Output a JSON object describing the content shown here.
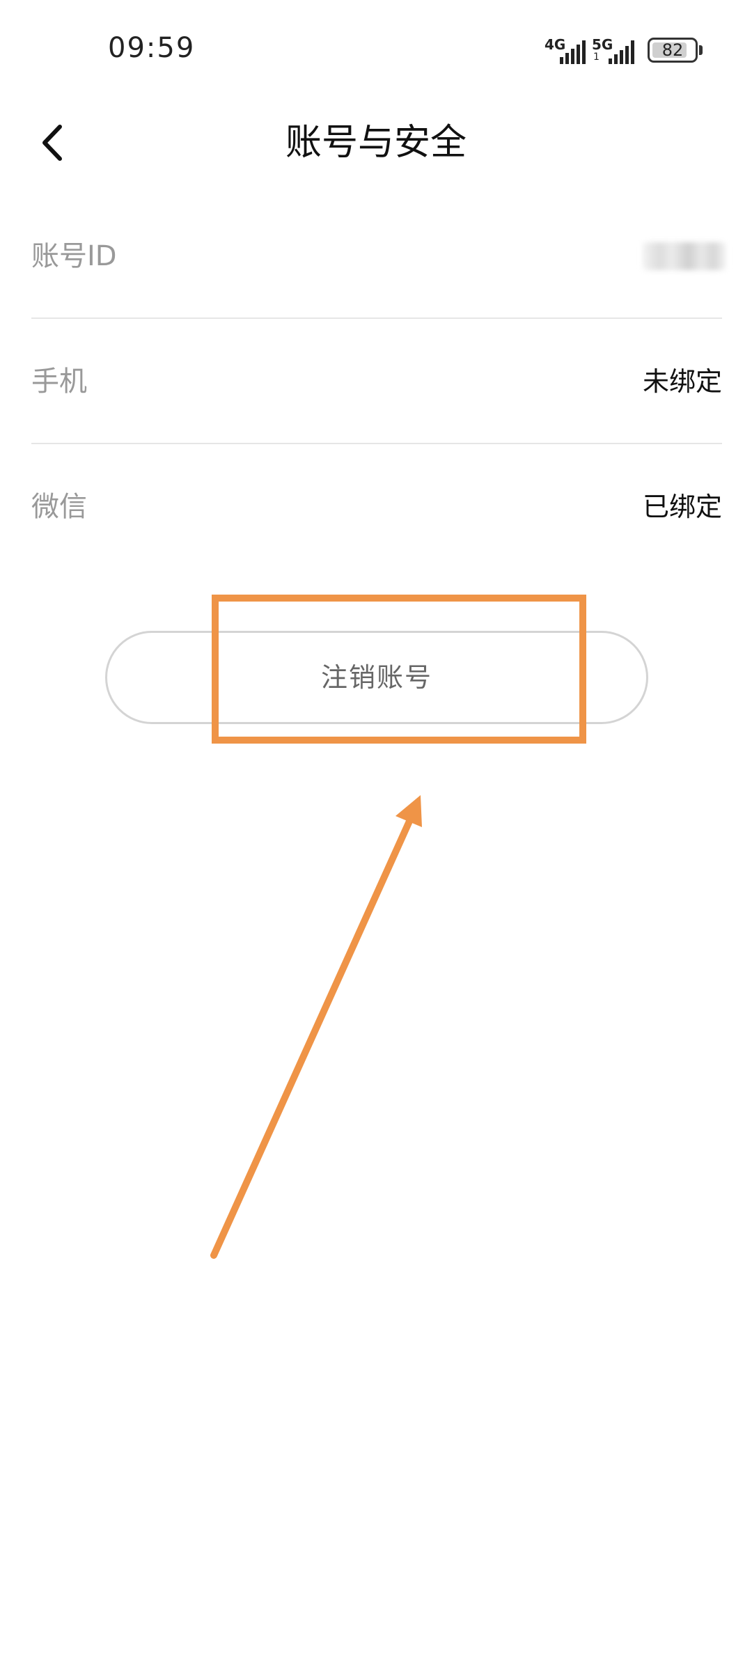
{
  "status_bar": {
    "time": "09:59",
    "signal_1": {
      "label": "4G"
    },
    "signal_2": {
      "label": "5G",
      "sub": "1"
    },
    "battery_level": "82"
  },
  "header": {
    "title": "账号与安全",
    "back_icon": "chevron-left-icon"
  },
  "rows": [
    {
      "label": "账号ID",
      "value": ""
    },
    {
      "label": "手机",
      "value": "未绑定"
    },
    {
      "label": "微信",
      "value": "已绑定"
    }
  ],
  "deregister_button": {
    "label": "注销账号"
  },
  "annotation": {
    "color": "#ef9447"
  }
}
